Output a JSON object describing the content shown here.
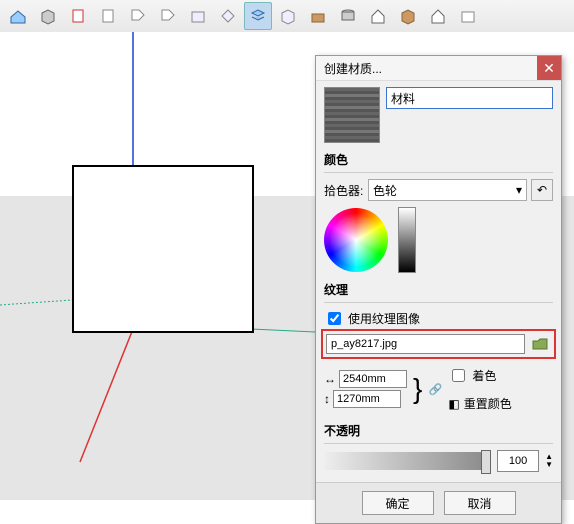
{
  "toolbar": {
    "items": [
      "house-3d",
      "cube",
      "doc",
      "doc2",
      "tag",
      "tag2",
      "box",
      "diamond",
      "layers",
      "cube2",
      "drawer",
      "cylinder",
      "house",
      "box2",
      "house2",
      "box3"
    ]
  },
  "panel": {
    "title": "创建材质...",
    "name_value": "材料",
    "sections": {
      "color": "颜色",
      "picker_label": "拾色器:",
      "picker_value": "色轮",
      "texture": "纹理",
      "use_texture": "使用纹理图像",
      "texture_file": "p_ay8217.jpg",
      "width": "2540mm",
      "height": "1270mm",
      "colorize": "着色",
      "reset_color": "重置颜色",
      "opacity": "不透明",
      "opacity_value": "100"
    },
    "buttons": {
      "ok": "确定",
      "cancel": "取消"
    }
  }
}
